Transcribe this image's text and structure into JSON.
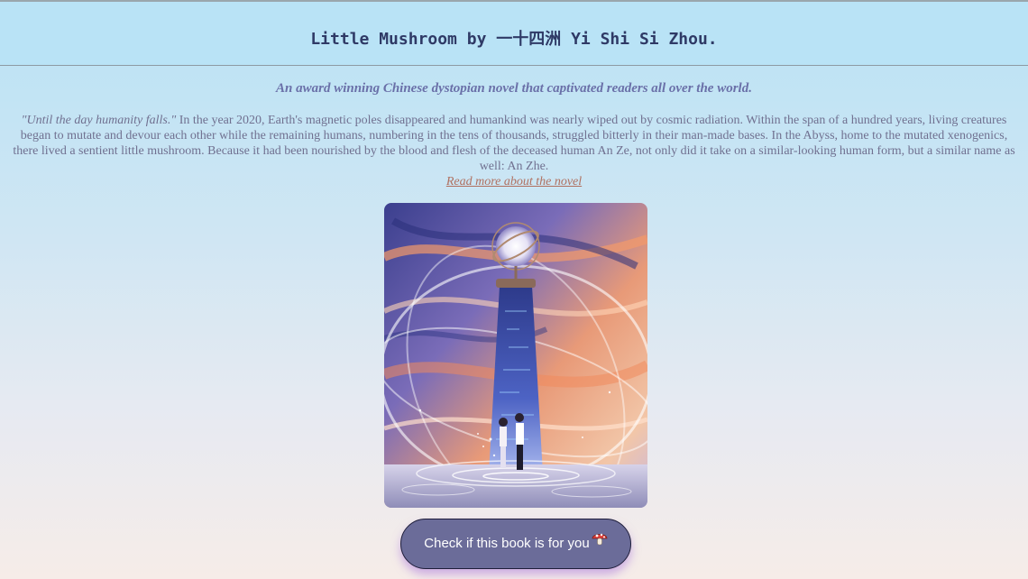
{
  "header": {
    "title": "Little Mushroom by 一十四洲 Yi Shi Si Zhou."
  },
  "main": {
    "tagline": "An award winning Chinese dystopian novel that captivated readers all over the world.",
    "synopsis_quote": "\"Until the day humanity falls.\"",
    "synopsis_body": " In the year 2020, Earth's magnetic poles disappeared and humankind was nearly wiped out by cosmic radiation. Within the span of a hundred years, living creatures began to mutate and devour each other while the remaining humans, numbering in the tens of thousands, struggled bitterly in their man-made bases. In the Abyss, home to the mutated xenogenics, there lived a sentient little mushroom. Because it had been nourished by the blood and flesh of the deceased human An Ze, not only did it take on a similar-looking human form, but a similar name as well: An Zhe.",
    "read_more_label": "Read more about the novel",
    "cover_icon": "book-cover-illustration",
    "cta_label": "Check if this book is for you",
    "cta_icon": "mushroom-icon"
  },
  "colors": {
    "header_bg": "#b9e3f6",
    "title_text": "#2f3a66",
    "tagline_text": "#6a70a8",
    "body_text": "#707090",
    "link_text": "#b07060",
    "button_bg": "#6b6c99",
    "button_glow": "#aa78dc"
  }
}
